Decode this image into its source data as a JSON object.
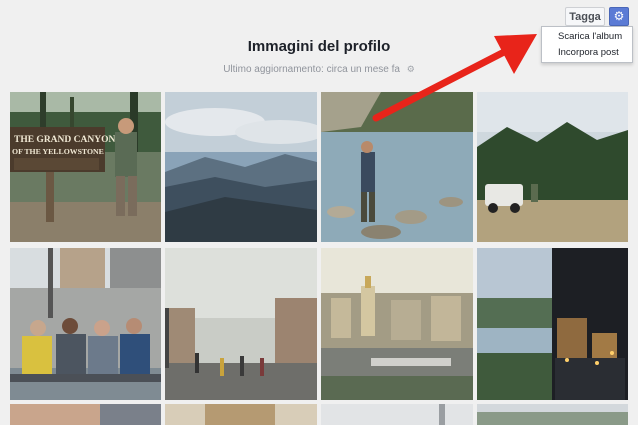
{
  "header": {
    "title": "Immagini del profilo",
    "subtitle": "Ultimo aggiornamento: circa un mese fa",
    "subtitle_icon": "gear-icon"
  },
  "toolbar": {
    "tag_label": "Tagga",
    "settings_icon": "gear-icon"
  },
  "dropdown": {
    "items": [
      {
        "label": "Scarica l'album"
      },
      {
        "label": "Incorpora post"
      }
    ]
  },
  "photos": {
    "sign_line1": "THE GRAND CANYON",
    "sign_line2": "OF THE YELLOWSTONE"
  },
  "colors": {
    "accent_blue": "#5b7bd5",
    "arrow_red": "#e8241a",
    "background": "#f0f0f0"
  }
}
